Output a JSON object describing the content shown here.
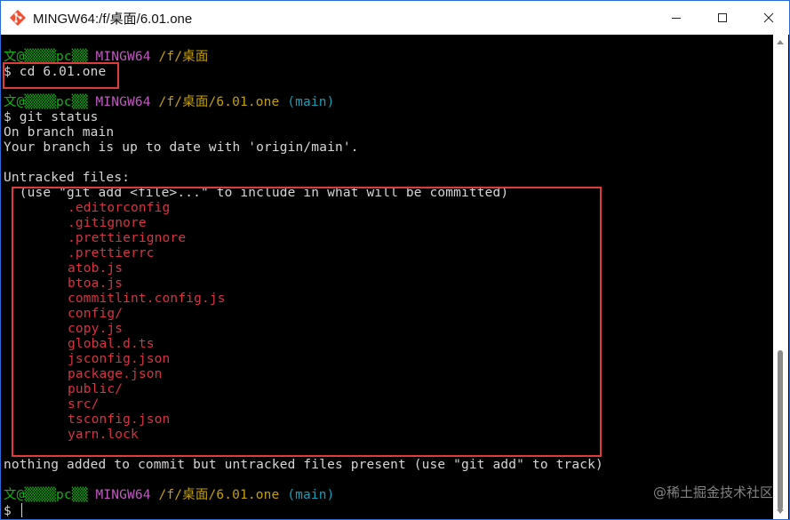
{
  "window": {
    "title": "MINGW64:/f/桌面/6.01.one",
    "icon": "git-bash-icon",
    "controls": [
      "minimize-icon",
      "maximize-icon",
      "close-icon"
    ]
  },
  "colors": {
    "user": "#11b311",
    "mingw": "#c05ac0",
    "path": "#c4a000",
    "branch": "#16a0b8",
    "untracked": "#d63344",
    "text": "#d6d6d6",
    "highlight": "#e03a3a"
  },
  "terminal": {
    "prompt1": {
      "user": "文@▒▒▒▒pc▒▒",
      "env": "MINGW64",
      "path": "/f/桌面"
    },
    "cmd1": "$ cd 6.01.one",
    "prompt2": {
      "user": "文@▒▒▒▒pc▒▒",
      "env": "MINGW64",
      "path": "/f/桌面/6.01.one",
      "branch": "(main)"
    },
    "cmd2": "$ git status",
    "status_lines": [
      "On branch main",
      "Your branch is up to date with 'origin/main'."
    ],
    "untracked_header": "Untracked files:",
    "untracked_hint": "  (use \"git add <file>...\" to include in what will be committed)",
    "untracked_files": [
      ".editorconfig",
      ".gitignore",
      ".prettierignore",
      ".prettierrc",
      "atob.js",
      "btoa.js",
      "commitlint.config.js",
      "config/",
      "copy.js",
      "global.d.ts",
      "jsconfig.json",
      "package.json",
      "public/",
      "src/",
      "tsconfig.json",
      "yarn.lock"
    ],
    "footer": "nothing added to commit but untracked files present (use \"git add\" to track)",
    "prompt3": {
      "user": "文@▒▒▒▒pc▒▒",
      "env": "MINGW64",
      "path": "/f/桌面/6.01.one",
      "branch": "(main)"
    },
    "cmd3": "$ "
  },
  "watermark": "@稀土掘金技术社区"
}
